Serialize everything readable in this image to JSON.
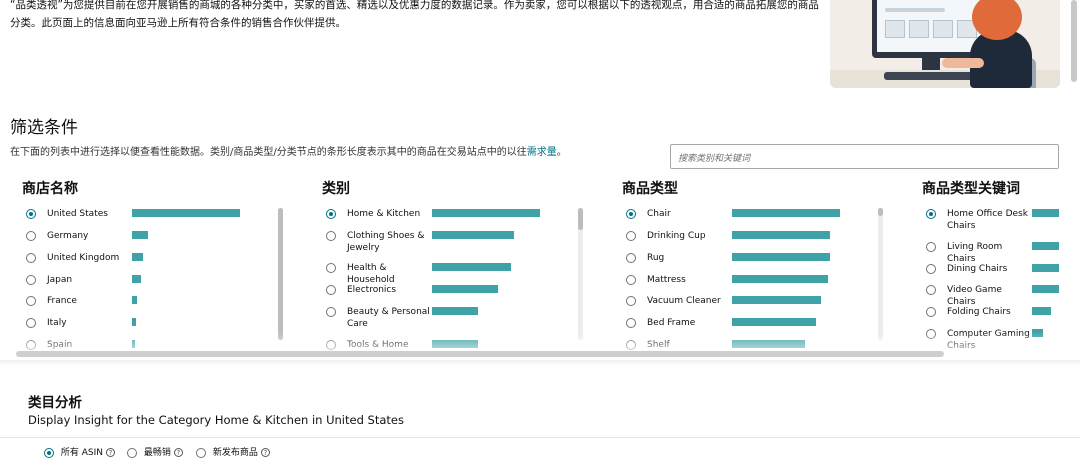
{
  "intro_text": "“品类透视”为您提供目前在您开展销售的商城的各种分类中，买家的首选、精选以及优惠力度的数据记录。作为卖家，您可以根据以下的透视观点，用合适的商品拓展您的商品分类。此页面上的信息面向亚马逊上所有符合条件的销售合作伙伴提供。",
  "filter": {
    "title": "筛选条件",
    "desc_prefix": "在下面的列表中进行选择以便查看性能数据。类别/商品类型/分类节点的条形长度表示其中的商品在交易站点中的以往",
    "desc_link": "需求量",
    "desc_suffix": "。",
    "search_placeholder": "搜索类别和关键词"
  },
  "columns": [
    {
      "header": "商店名称",
      "items": [
        {
          "label": "United States",
          "demand": 100,
          "selected": true
        },
        {
          "label": "Germany",
          "demand": 15,
          "selected": false
        },
        {
          "label": "United Kingdom",
          "demand": 10,
          "selected": false
        },
        {
          "label": "Japan",
          "demand": 8,
          "selected": false
        },
        {
          "label": "France",
          "demand": 5,
          "selected": false
        },
        {
          "label": "Italy",
          "demand": 4,
          "selected": false
        },
        {
          "label": "Spain",
          "demand": 3,
          "selected": false
        }
      ]
    },
    {
      "header": "类别",
      "items": [
        {
          "label": "Home & Kitchen",
          "demand": 100,
          "selected": true
        },
        {
          "label": "Clothing Shoes & Jewelry",
          "demand": 76,
          "selected": false
        },
        {
          "label": "Health & Household",
          "demand": 73,
          "selected": false
        },
        {
          "label": "Electronics",
          "demand": 61,
          "selected": false
        },
        {
          "label": "Beauty & Personal Care",
          "demand": 43,
          "selected": false
        },
        {
          "label": "Tools & Home",
          "demand": 43,
          "selected": false
        }
      ]
    },
    {
      "header": "商品类型",
      "items": [
        {
          "label": "Chair",
          "demand": 100,
          "selected": true
        },
        {
          "label": "Drinking Cup",
          "demand": 91,
          "selected": false
        },
        {
          "label": "Rug",
          "demand": 91,
          "selected": false
        },
        {
          "label": "Mattress",
          "demand": 89,
          "selected": false
        },
        {
          "label": "Vacuum Cleaner",
          "demand": 82,
          "selected": false
        },
        {
          "label": "Bed Frame",
          "demand": 78,
          "selected": false
        },
        {
          "label": "Shelf",
          "demand": 68,
          "selected": false
        }
      ]
    },
    {
      "header": "商品类型关键词",
      "items": [
        {
          "label": "Home Office Desk Chairs",
          "demand": 100,
          "selected": true
        },
        {
          "label": "Living Room Chairs",
          "demand": 100,
          "selected": false
        },
        {
          "label": "Dining Chairs",
          "demand": 100,
          "selected": false
        },
        {
          "label": "Video Game Chairs",
          "demand": 100,
          "selected": false
        },
        {
          "label": "Folding Chairs",
          "demand": 70,
          "selected": false
        },
        {
          "label": "Computer Gaming Chairs",
          "demand": 40,
          "selected": false
        }
      ]
    }
  ],
  "analysis": {
    "title": "类目分析",
    "subtitle": "Display Insight for the Category Home & Kitchen in United States",
    "tabs": [
      {
        "label": "所有 ASIN",
        "selected": true
      },
      {
        "label": "最畅销",
        "selected": false
      },
      {
        "label": "新发布商品",
        "selected": false
      }
    ]
  },
  "colors": {
    "bar": "#3fa2a7",
    "accent": "#007185"
  }
}
